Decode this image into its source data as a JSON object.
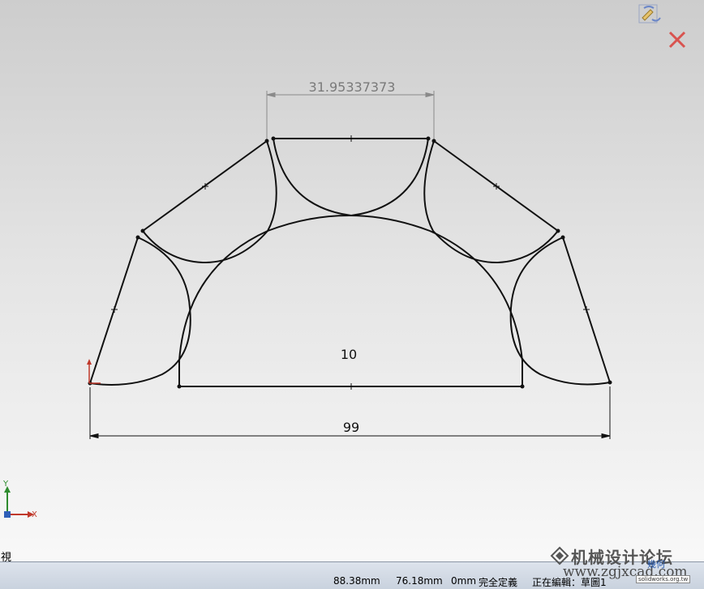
{
  "sketch": {
    "dim_top": "31.95337373",
    "dim_inner": "10",
    "dim_bottom": "99"
  },
  "triad": {
    "y_label": "Y",
    "x_label": "X"
  },
  "view": {
    "label": "視"
  },
  "status": {
    "x_coord": "88.38mm",
    "y_coord": "76.18mm",
    "z_coord": "0mm",
    "definition": "完全定義",
    "editing": "正在編輯：草圖1"
  },
  "watermark": {
    "title": "机械设计论坛",
    "url": "www.zgjxcad.com",
    "badge": "幾何",
    "small": "solidworks.org.tw"
  },
  "colors": {
    "sketch_line": "#111111",
    "dimension": "#7a7a7a",
    "triad_y": "#2e8b2e",
    "triad_x": "#c0392b",
    "cancel": "#d9534f"
  }
}
